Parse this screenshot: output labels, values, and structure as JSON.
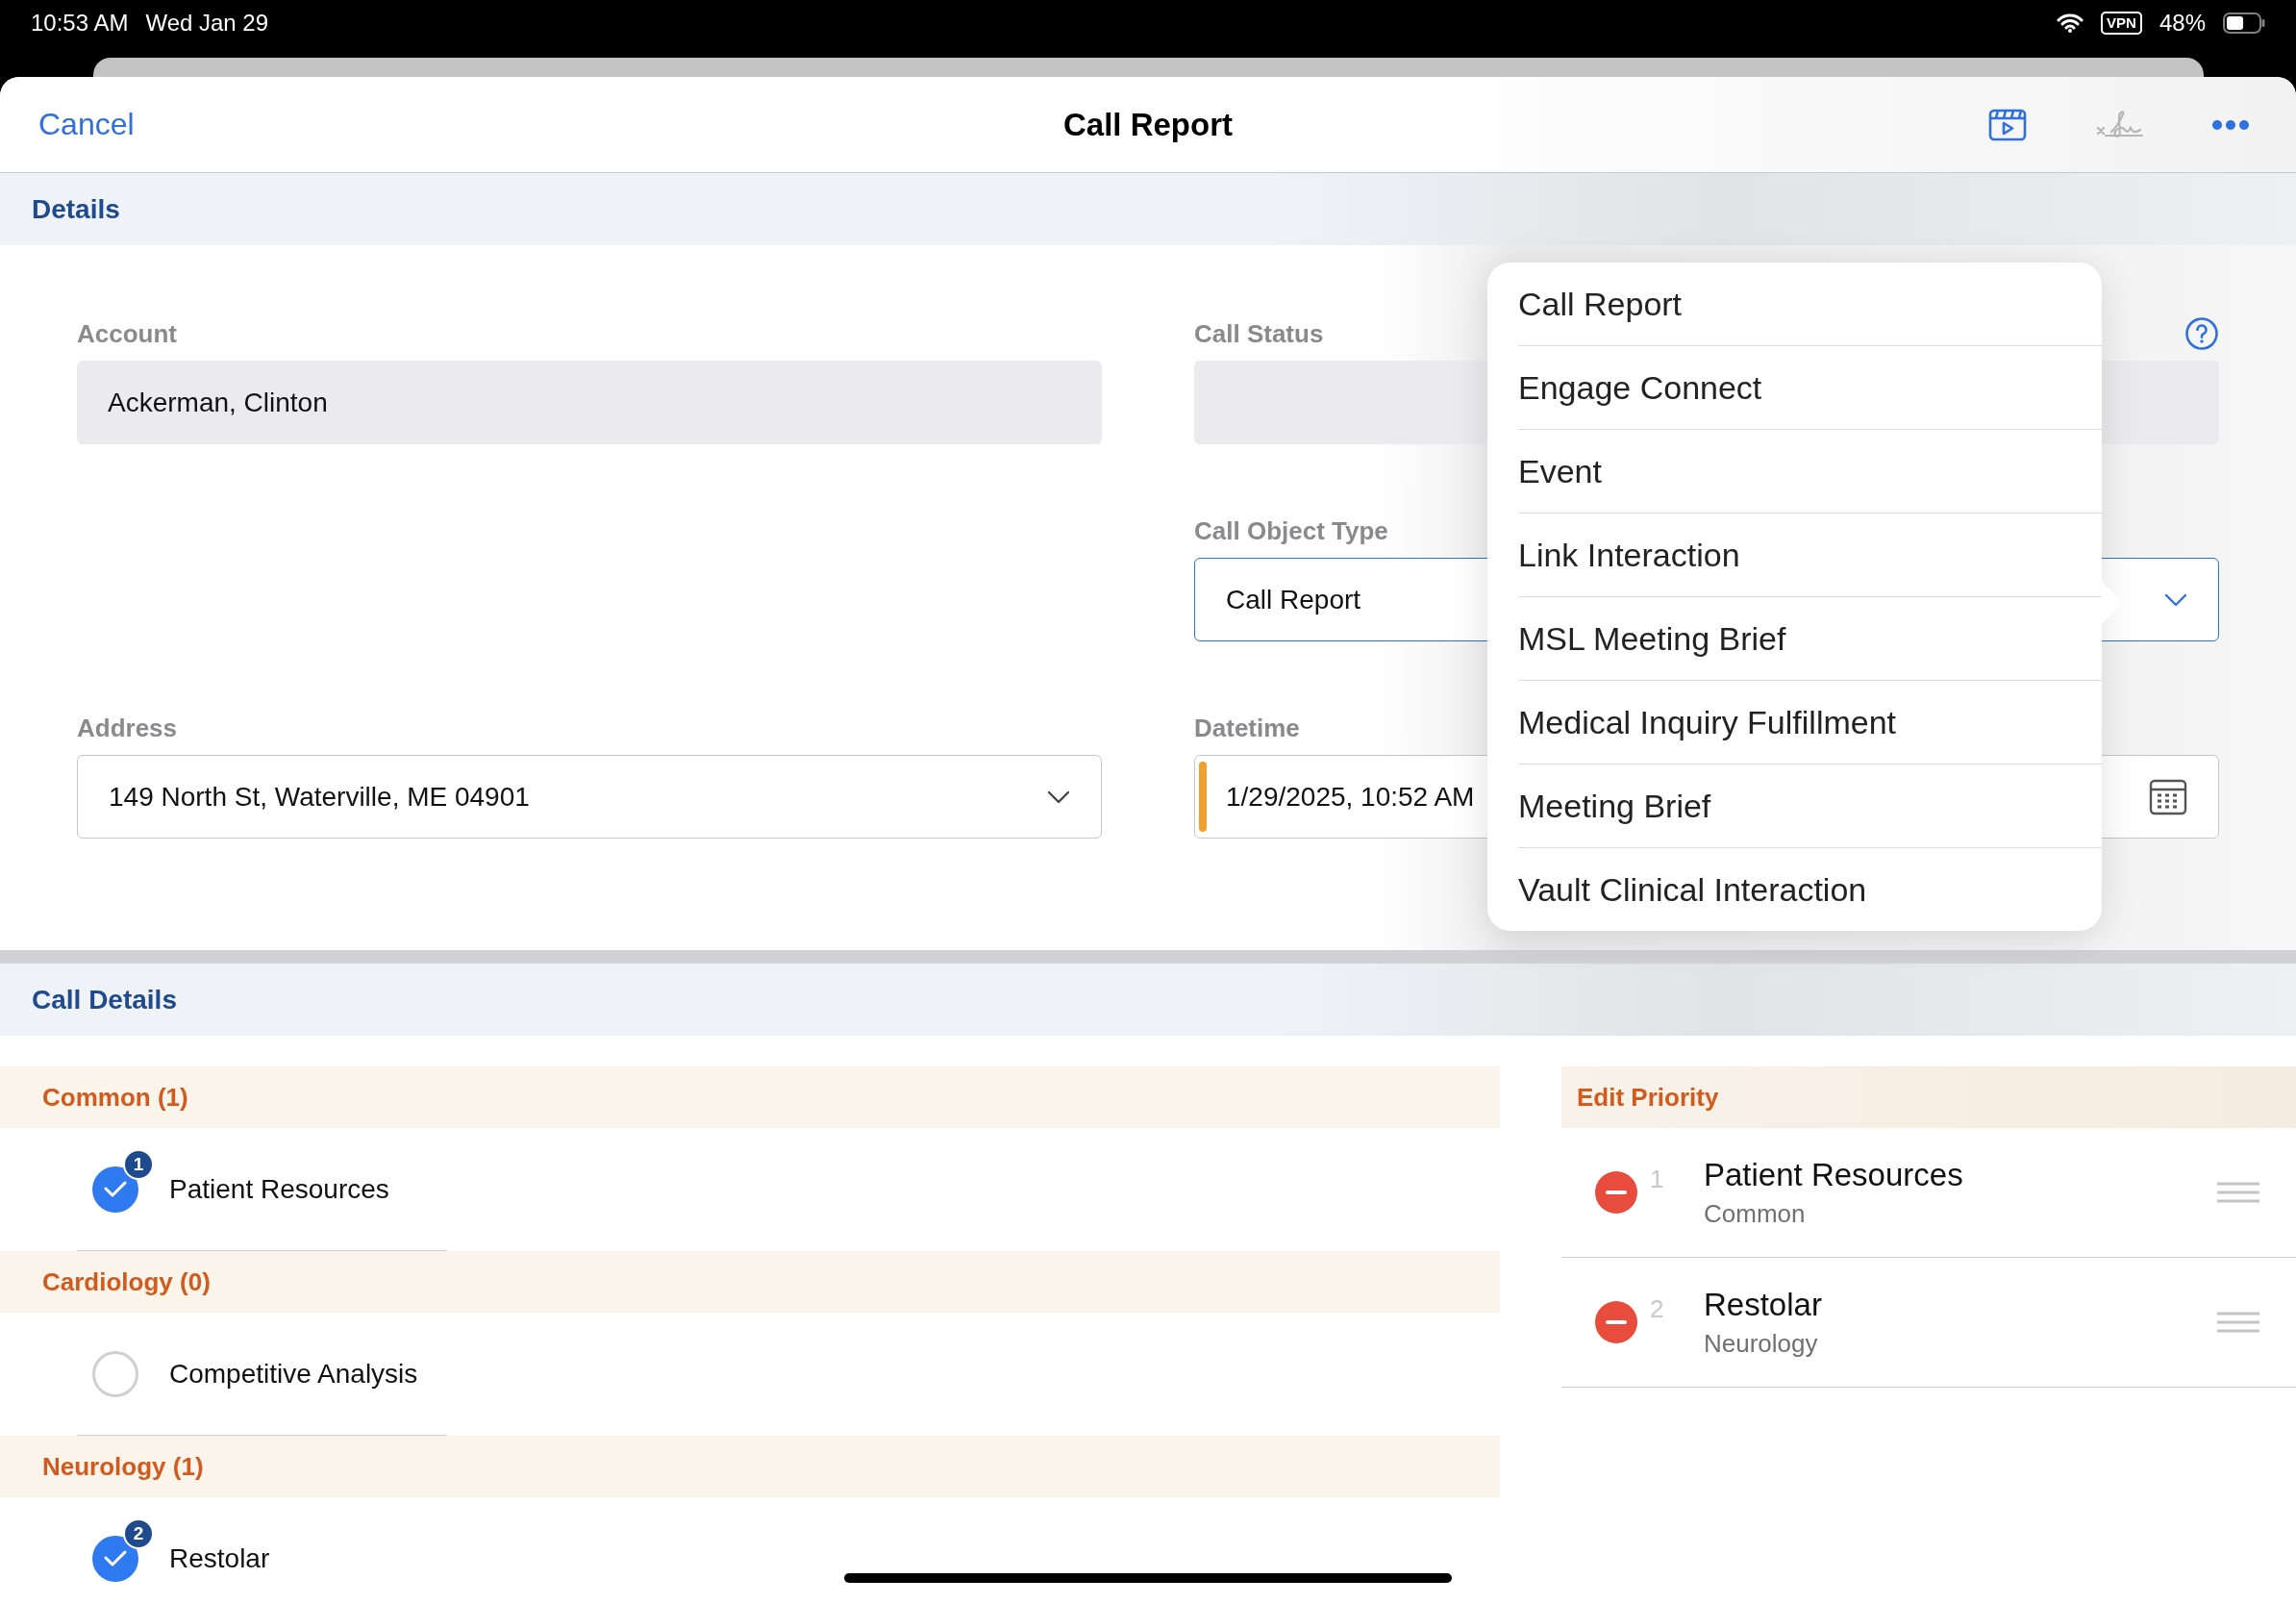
{
  "status_bar": {
    "time": "10:53 AM",
    "date": "Wed Jan 29",
    "vpn": "VPN",
    "battery": "48%"
  },
  "header": {
    "cancel": "Cancel",
    "title": "Call Report"
  },
  "details": {
    "title": "Details",
    "rows": [
      {
        "left": {
          "label": "Account",
          "value": "Ackerman, Clinton",
          "kind": "readonly"
        },
        "right": {
          "label": "Call Status",
          "kind": "readonly",
          "help": true
        }
      },
      {
        "right": {
          "label": "Call Object Type",
          "value": "Call Report",
          "kind": "select",
          "focused": true
        }
      },
      {
        "left": {
          "label": "Address",
          "value": "149 North St, Waterville, ME 04901",
          "kind": "select"
        },
        "right": {
          "label": "Datetime",
          "value": "1/29/2025, 10:52 AM",
          "kind": "datetime",
          "required": true
        }
      }
    ]
  },
  "menu": {
    "items": [
      "Call Report",
      "Engage Connect",
      "Event",
      "Link Interaction",
      "MSL Meeting Brief",
      "Medical Inquiry Fulfillment",
      "Meeting Brief",
      "Vault Clinical Interaction"
    ]
  },
  "call_details": {
    "title": "Call Details",
    "groups": [
      {
        "title": "Common (1)",
        "items": [
          {
            "label": "Patient Resources",
            "checked": true,
            "badge": "1"
          }
        ]
      },
      {
        "title": "Cardiology (0)",
        "items": [
          {
            "label": "Competitive Analysis",
            "checked": false
          }
        ]
      },
      {
        "title": "Neurology (1)",
        "items": [
          {
            "label": "Restolar",
            "checked": true,
            "badge": "2"
          }
        ]
      }
    ],
    "priority": {
      "title": "Edit Priority",
      "rows": [
        {
          "number": "1",
          "title": "Patient Resources",
          "subtitle": "Common"
        },
        {
          "number": "2",
          "title": "Restolar",
          "subtitle": "Neurology"
        }
      ]
    }
  }
}
